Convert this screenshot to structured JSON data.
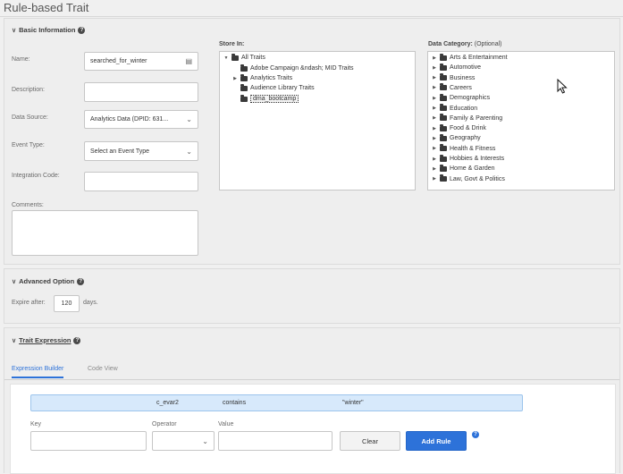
{
  "page": {
    "title": "Rule-based Trait"
  },
  "basic": {
    "heading": "Basic Information",
    "name_label": "Name:",
    "name_value": "searched_for_winter",
    "description_label": "Description:",
    "description_value": "",
    "data_source_label": "Data Source:",
    "data_source_value": "Analytics Data (DPID: 631...",
    "event_type_label": "Event Type:",
    "event_type_value": "Select an Event Type",
    "integration_code_label": "Integration Code:",
    "integration_code_value": "",
    "comments_label": "Comments:",
    "comments_value": ""
  },
  "store_in": {
    "label": "Store In:",
    "root": "All Traits",
    "children": [
      {
        "label": "Adobe Campaign &ndash; MID Traits",
        "expandable": false
      },
      {
        "label": "Analytics Traits",
        "expandable": true
      },
      {
        "label": "Audience Library Traits",
        "expandable": false
      },
      {
        "label": "dma_bootcamp",
        "expandable": false,
        "selected": true
      }
    ]
  },
  "data_category": {
    "label": "Data Category:",
    "optional": "(Optional)",
    "items": [
      "Arts & Entertainment",
      "Automotive",
      "Business",
      "Careers",
      "Demographics",
      "Education",
      "Family & Parenting",
      "Food & Drink",
      "Geography",
      "Health & Fitness",
      "Hobbies & Interests",
      "Home & Garden",
      "Law, Govt & Politics"
    ]
  },
  "advanced": {
    "heading": "Advanced Option",
    "expire_label": "Expire after:",
    "expire_value": "120",
    "expire_unit": "days."
  },
  "trait_expression": {
    "heading": "Trait Expression",
    "tabs": [
      "Expression Builder",
      "Code View"
    ],
    "expression": {
      "key": "c_evar2",
      "operator": "contains",
      "value": "\"winter\""
    },
    "key_label": "Key",
    "operator_label": "Operator",
    "value_label": "Value",
    "clear_label": "Clear",
    "add_rule_label": "Add Rule"
  },
  "icons": {
    "collapse": "chevron-down-icon",
    "help": "help-icon",
    "folder": "folder-icon",
    "expand": "expand-triangle-icon"
  },
  "colors": {
    "accent": "#2d72d9",
    "expression_bg": "#d7e9fb"
  }
}
